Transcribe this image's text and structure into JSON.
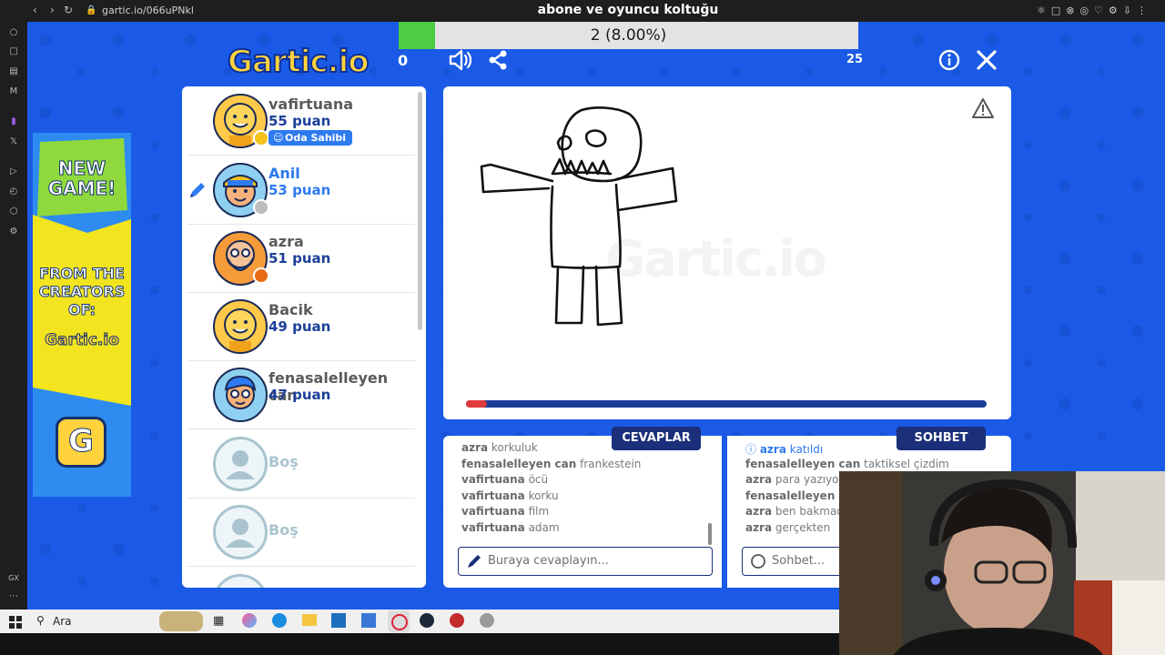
{
  "browser": {
    "url": "gartic.io/066uPNkl",
    "title": "abone ve oyuncu koltuğu"
  },
  "game": {
    "logo": "Gartic.io",
    "my_score": "0",
    "round": "25",
    "progress": {
      "label": "2 (8.00%)",
      "fraction": 0.08
    },
    "timer_fraction": 0.04
  },
  "players": [
    {
      "name": "vafirtuana",
      "points": "55 puan",
      "badge": "Oda Sahibi",
      "dot_color": "#f4c21b",
      "avatar": "yellow"
    },
    {
      "name": "Anil",
      "points": "53 puan",
      "badge": "",
      "dot_color": "#bdbdbd",
      "avatar": "cap",
      "drawing": true
    },
    {
      "name": "azra",
      "points": "51 puan",
      "badge": "",
      "dot_color": "#e76b12",
      "avatar": "beard"
    },
    {
      "name": "Bacik",
      "points": "49 puan",
      "badge": "",
      "dot_color": "",
      "avatar": "yellow"
    },
    {
      "name": "fenasalelleyen can",
      "points": "47 puan",
      "badge": "",
      "dot_color": "",
      "avatar": "curly"
    },
    {
      "name": "Boş",
      "points": "",
      "badge": "",
      "dot_color": "",
      "avatar": "empty"
    },
    {
      "name": "Boş",
      "points": "",
      "badge": "",
      "dot_color": "",
      "avatar": "empty"
    }
  ],
  "answers": {
    "tab": "CEVAPLAR",
    "placeholder": "Buraya cevaplayın...",
    "messages": [
      {
        "user": "azra",
        "text": "korkuluk"
      },
      {
        "user": "fenasalelleyen can",
        "text": "frankestein"
      },
      {
        "user": "vafirtuana",
        "text": "öcü"
      },
      {
        "user": "vafirtuana",
        "text": "korku"
      },
      {
        "user": "vafirtuana",
        "text": "film"
      },
      {
        "user": "vafirtuana",
        "text": "adam"
      }
    ]
  },
  "chat": {
    "tab": "SOHBET",
    "placeholder": "Sohbet...",
    "messages": [
      {
        "user": "azra",
        "text": "katıldı"
      },
      {
        "user": "fenasalelleyen can",
        "text": "taktiksel çizdim"
      },
      {
        "user": "azra",
        "text": "para yazıyo b"
      },
      {
        "user": "fenasalelleyen can",
        "text": ""
      },
      {
        "user": "azra",
        "text": "ben bakmadı"
      },
      {
        "user": "azra",
        "text": "gerçekten"
      }
    ]
  },
  "ad": {
    "line1": "NEW GAME!",
    "line2": "FROM THE CREATORS OF:",
    "logo": "Gartic.io",
    "letter": "G"
  },
  "taskbar": {
    "search": "Ara"
  },
  "icons": [
    "back-arrow-icon",
    "forward-arrow-icon",
    "reload-icon",
    "lock-icon",
    "sound-icon",
    "share-icon",
    "info-icon",
    "close-icon",
    "pencil-icon",
    "warning-icon",
    "search-icon",
    "windows-start-icon"
  ]
}
